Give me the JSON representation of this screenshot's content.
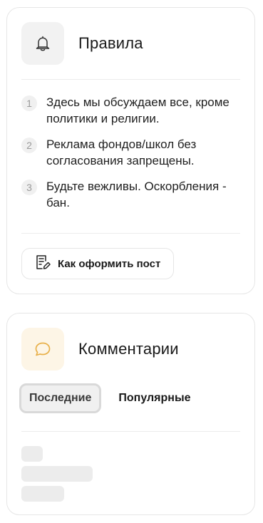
{
  "rules_card": {
    "title": "Правила",
    "icon": "bell-icon",
    "items": [
      {
        "number": "1",
        "text": "Здесь мы обсуждаем все, кроме политики и религии."
      },
      {
        "number": "2",
        "text": "Реклама фондов/школ без согласования запрещены."
      },
      {
        "number": "3",
        "text": "Будьте вежливы. Оскорбления - бан."
      }
    ],
    "post_button": {
      "label": "Как оформить пост",
      "icon": "document-edit-icon"
    }
  },
  "comments_card": {
    "title": "Комментарии",
    "icon": "chat-bubble-icon",
    "tabs": [
      {
        "label": "Последние",
        "active": true
      },
      {
        "label": "Популярные",
        "active": false
      }
    ]
  },
  "colors": {
    "accent": "#e8b04a",
    "border": "#e6e6e6",
    "icon_bg_gray": "#f2f2f2",
    "icon_bg_cream": "#fdf5e6"
  }
}
